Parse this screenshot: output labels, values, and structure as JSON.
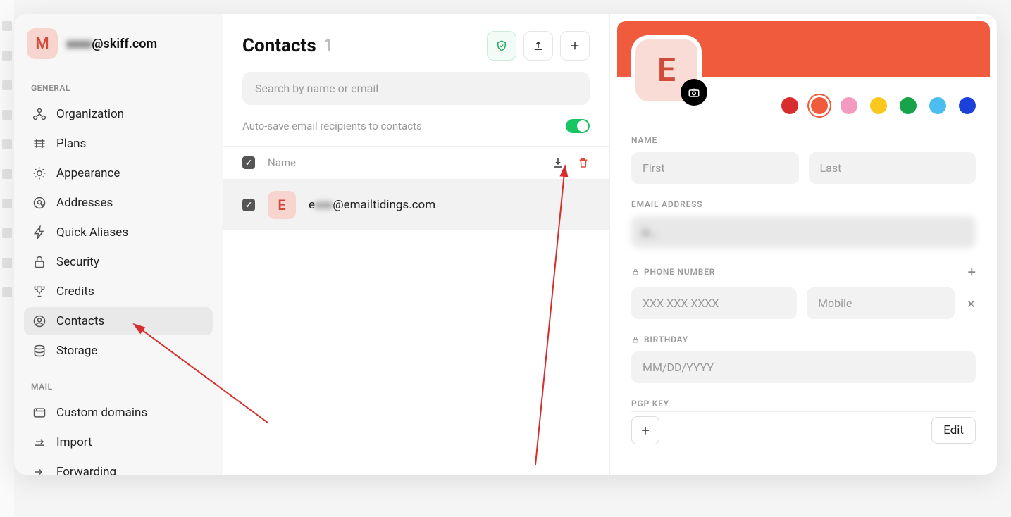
{
  "user": {
    "avatar_letter": "M",
    "email_prefix": "xxxx",
    "email_suffix": "@skiff.com"
  },
  "sidebar": {
    "section_general": "GENERAL",
    "section_mail": "MAIL",
    "general_items": [
      {
        "label": "Organization"
      },
      {
        "label": "Plans"
      },
      {
        "label": "Appearance"
      },
      {
        "label": "Addresses"
      },
      {
        "label": "Quick Aliases"
      },
      {
        "label": "Security"
      },
      {
        "label": "Credits"
      },
      {
        "label": "Contacts"
      },
      {
        "label": "Storage"
      }
    ],
    "mail_items": [
      {
        "label": "Custom domains"
      },
      {
        "label": "Import"
      },
      {
        "label": "Forwarding"
      }
    ]
  },
  "contacts": {
    "title": "Contacts",
    "count": "1",
    "search_placeholder": "Search by name or email",
    "autosave_label": "Auto-save email recipients to contacts",
    "col_name": "Name",
    "row": {
      "avatar_letter": "E",
      "prefix": "e",
      "hidden": "xxx",
      "suffix": "@emailtidings.com"
    }
  },
  "detail": {
    "avatar_letter": "E",
    "colors": [
      "#d72d2d",
      "#ef5b3c",
      "#f49ac1",
      "#f8c81c",
      "#17a34a",
      "#4bbdee",
      "#1b41d8"
    ],
    "selected_color_index": 1,
    "labels": {
      "name": "NAME",
      "email": "EMAIL ADDRESS",
      "phone": "PHONE NUMBER",
      "birthday": "BIRTHDAY",
      "pgp": "PGP KEY"
    },
    "placeholders": {
      "first": "First",
      "last": "Last",
      "phone": "XXX-XXX-XXXX",
      "phone_type": "Mobile",
      "birthday": "MM/DD/YYYY"
    },
    "email_value_hidden": "e...",
    "edit_label": "Edit"
  }
}
